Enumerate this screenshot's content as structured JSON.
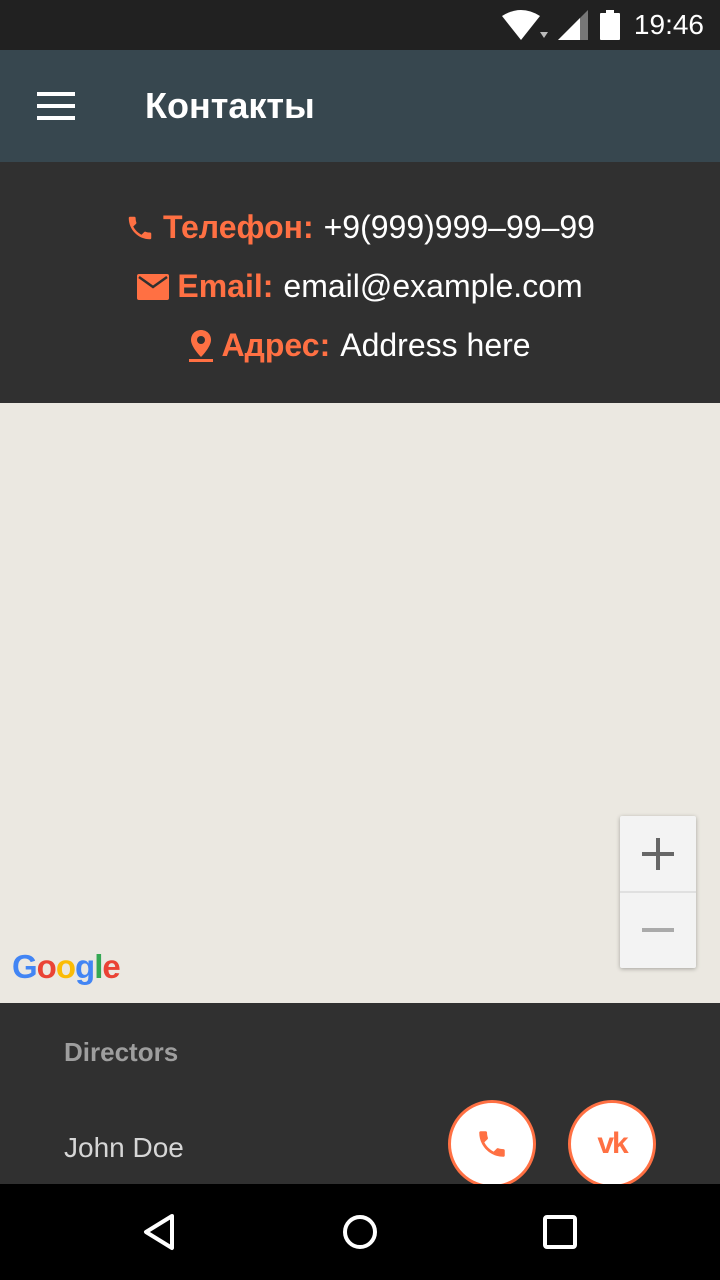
{
  "status_bar": {
    "time": "19:46",
    "icons": [
      "wifi-icon",
      "signal-icon",
      "battery-icon"
    ]
  },
  "app_bar": {
    "title": "Контакты",
    "menu_icon": "menu-icon"
  },
  "contacts": {
    "phone": {
      "label": "Телефон:",
      "value": "+9(999)999–99–99",
      "icon": "phone-icon"
    },
    "email": {
      "label": "Email:",
      "value": "email@example.com",
      "icon": "mail-icon"
    },
    "address": {
      "label": "Адрес:",
      "value": "Address here",
      "icon": "location-pin-icon"
    }
  },
  "map": {
    "zoom_in": "+",
    "zoom_out": "−",
    "logo": "Google"
  },
  "directors": {
    "heading": "Directors",
    "names": [
      "John Doe"
    ],
    "actions": [
      "phone-icon",
      "vk-icon"
    ]
  },
  "colors": {
    "accent": "#ff7043",
    "app_bar": "#37474f",
    "background": "#303030",
    "map": "#ebe8e1"
  }
}
